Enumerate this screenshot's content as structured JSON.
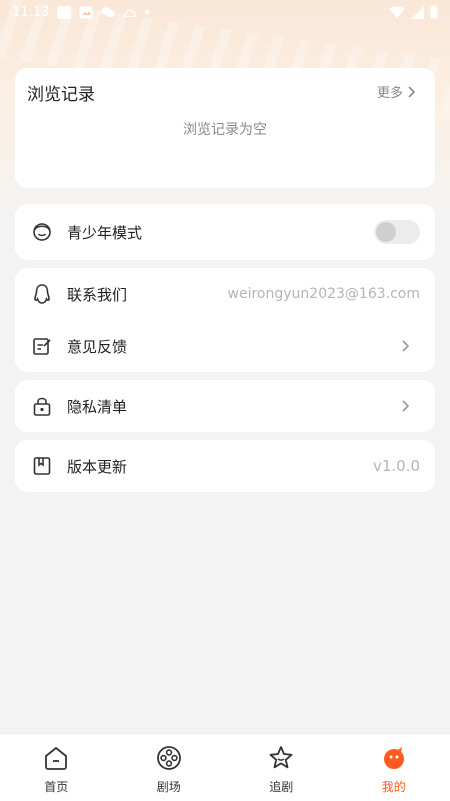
{
  "status_bar": {
    "time": "11:13"
  },
  "history": {
    "title": "浏览记录",
    "more_label": "更多",
    "empty_text": "浏览记录为空"
  },
  "teen_mode": {
    "label": "青少年模式",
    "enabled": false
  },
  "contact": {
    "label": "联系我们",
    "email": "weirongyun2023@163.com"
  },
  "feedback": {
    "label": "意见反馈"
  },
  "privacy": {
    "label": "隐私清单"
  },
  "version": {
    "label": "版本更新",
    "value": "v1.0.0"
  },
  "tabs": [
    {
      "label": "首页",
      "icon": "home-icon",
      "active": false
    },
    {
      "label": "剧场",
      "icon": "film-reel-icon",
      "active": false
    },
    {
      "label": "追剧",
      "icon": "star-icon",
      "active": false
    },
    {
      "label": "我的",
      "icon": "profile-face-icon",
      "active": true
    }
  ],
  "colors": {
    "accent": "#ff5a1f",
    "background": "#f3f3f3"
  }
}
